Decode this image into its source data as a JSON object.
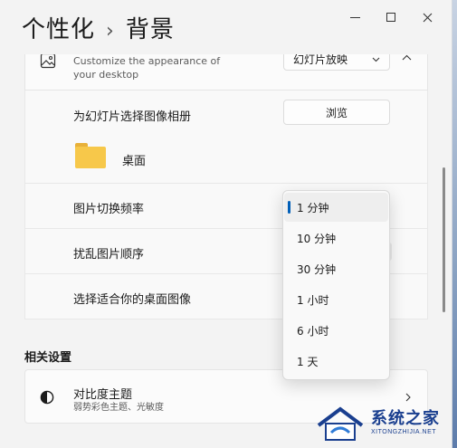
{
  "titlebar": {
    "part1": "个性化",
    "separator": "›",
    "part2": "背景"
  },
  "background_card": {
    "description": "Customize the appearance of your desktop",
    "dropdown_value": "幻灯片放映",
    "expand_glyph": "^"
  },
  "album_row": {
    "label": "为幻灯片选择图像相册",
    "button": "浏览",
    "folder_name": "桌面"
  },
  "rows": {
    "frequency": "图片切换频率",
    "shuffle": "扰乱图片顺序",
    "fit": "选择适合你的桌面图像"
  },
  "flyout": {
    "options": [
      "1 分钟",
      "10 分钟",
      "30 分钟",
      "1 小时",
      "6 小时",
      "1 天"
    ],
    "selected_index": 0
  },
  "related": {
    "heading": "相关设置",
    "contrast_title": "对比度主题",
    "contrast_sub": "弱势彩色主题、光敏度"
  },
  "watermark": {
    "text": "系统之家",
    "sub": "XITONGZHIJIA.NET"
  },
  "colors": {
    "accent": "#005fb8",
    "window_bg": "#f3f3f3",
    "card_bg": "#fbfbfb"
  }
}
